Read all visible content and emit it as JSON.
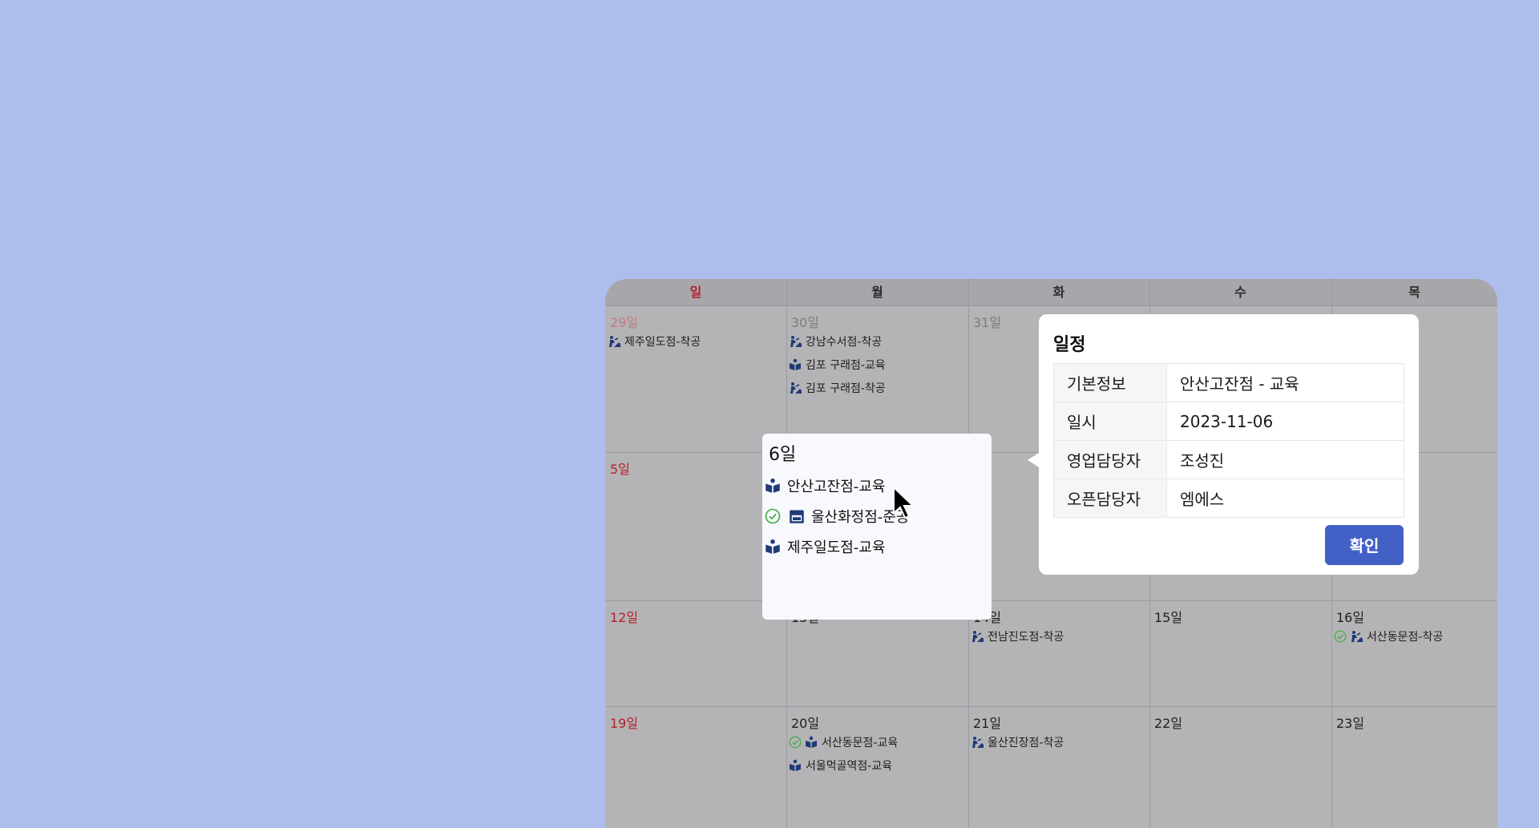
{
  "calendar": {
    "weekdays": [
      "일",
      "월",
      "화",
      "수",
      "목"
    ],
    "weeks": [
      [
        {
          "day": "29일",
          "dim": true,
          "sun": true,
          "events": [
            {
              "icon": "construction-icon",
              "label": "제주일도점-착공"
            }
          ]
        },
        {
          "day": "30일",
          "dim": true,
          "events": [
            {
              "icon": "construction-icon",
              "label": "강남수서점-착공"
            },
            {
              "icon": "education-icon",
              "label": "김포 구래점-교육"
            },
            {
              "icon": "construction-icon",
              "label": "김포 구래점-착공"
            }
          ]
        },
        {
          "day": "31일",
          "dim": true,
          "events": []
        },
        {
          "day": "",
          "events": []
        },
        {
          "day": "",
          "events": []
        }
      ],
      [
        {
          "day": "5일",
          "sun": true,
          "events": []
        },
        {
          "day": "",
          "events": []
        },
        {
          "day": "",
          "events": []
        },
        {
          "day": "",
          "events": []
        },
        {
          "day": "",
          "events": []
        }
      ],
      [
        {
          "day": "12일",
          "sun": true,
          "events": []
        },
        {
          "day": "13일",
          "events": []
        },
        {
          "day": "14일",
          "events": [
            {
              "icon": "construction-icon",
              "label": "전남진도점-착공"
            }
          ]
        },
        {
          "day": "15일",
          "events": []
        },
        {
          "day": "16일",
          "events": [
            {
              "icon": "construction-icon",
              "check": true,
              "label": "서산동문점-착공"
            }
          ]
        }
      ],
      [
        {
          "day": "19일",
          "sun": true,
          "events": []
        },
        {
          "day": "20일",
          "events": [
            {
              "icon": "education-icon",
              "check": true,
              "label": "서산동문점-교육"
            },
            {
              "icon": "education-icon",
              "label": "서울먹골역점-교육"
            }
          ]
        },
        {
          "day": "21일",
          "events": [
            {
              "icon": "construction-icon",
              "label": "울산진장점-착공"
            }
          ]
        },
        {
          "day": "22일",
          "events": []
        },
        {
          "day": "23일",
          "events": []
        }
      ]
    ]
  },
  "day_popup": {
    "title": "6일",
    "events": [
      {
        "icon": "education-icon",
        "label": "안산고잔점-교육"
      },
      {
        "icon": "store-icon",
        "check": true,
        "label": "울산화정점-준공"
      },
      {
        "icon": "education-icon",
        "label": "제주일도점-교육"
      }
    ]
  },
  "detail": {
    "title": "일정",
    "rows": [
      {
        "key": "기본정보",
        "value": "안산고잔점 - 교육"
      },
      {
        "key": "일시",
        "value": "2023-11-06"
      },
      {
        "key": "영업담당자",
        "value": "조성진"
      },
      {
        "key": "오픈담당자",
        "value": "엠에스"
      }
    ],
    "confirm_label": "확인"
  },
  "colors": {
    "background": "#adbeed",
    "sunday": "#b5202a",
    "icon": "#1f3a78",
    "check": "#4caf50",
    "confirm_button": "#4260c6"
  }
}
